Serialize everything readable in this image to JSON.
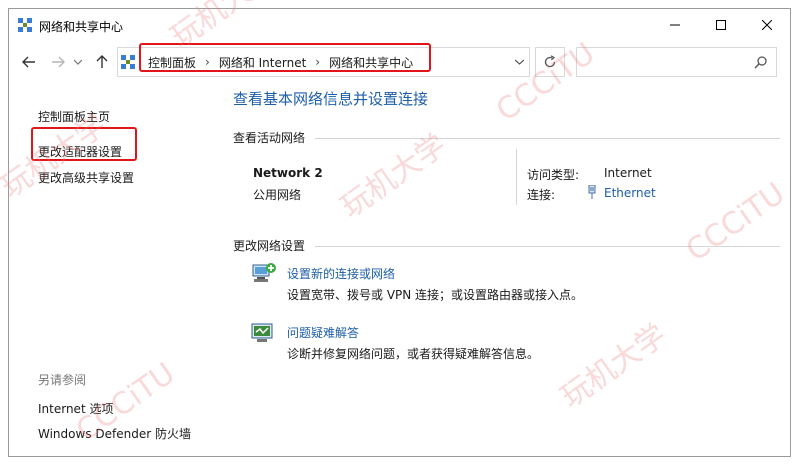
{
  "window": {
    "title": "网络和共享中心"
  },
  "nav": {
    "breadcrumbs": [
      "控制面板",
      "网络和 Internet",
      "网络和共享中心"
    ],
    "search_placeholder": ""
  },
  "sidebar": {
    "home": "控制面板主页",
    "change_adapter": "更改适配器设置",
    "change_sharing": "更改高级共享设置",
    "see_also_header": "另请参阅",
    "see_also_items": [
      "Internet 选项",
      "Windows Defender 防火墙"
    ]
  },
  "main": {
    "title": "查看基本网络信息并设置连接",
    "active_section": "查看活动网络",
    "network": {
      "name": "Network 2",
      "profile": "公用网络",
      "access_type_label": "访问类型:",
      "access_type_value": "Internet",
      "connection_label": "连接:",
      "connection_value": "Ethernet"
    },
    "change_section": "更改网络设置",
    "tasks": [
      {
        "title": "设置新的连接或网络",
        "desc": "设置宽带、拨号或 VPN 连接；或设置路由器或接入点。",
        "icon": "new-connection-icon"
      },
      {
        "title": "问题疑难解答",
        "desc": "诊断并修复网络问题，或者获得疑难解答信息。",
        "icon": "troubleshoot-icon"
      }
    ]
  },
  "watermark": {
    "text_cn": "玩机大学",
    "text_en": "CCCiTU"
  },
  "colors": {
    "link": "#1e5ea8",
    "highlight": "#e2151b"
  }
}
